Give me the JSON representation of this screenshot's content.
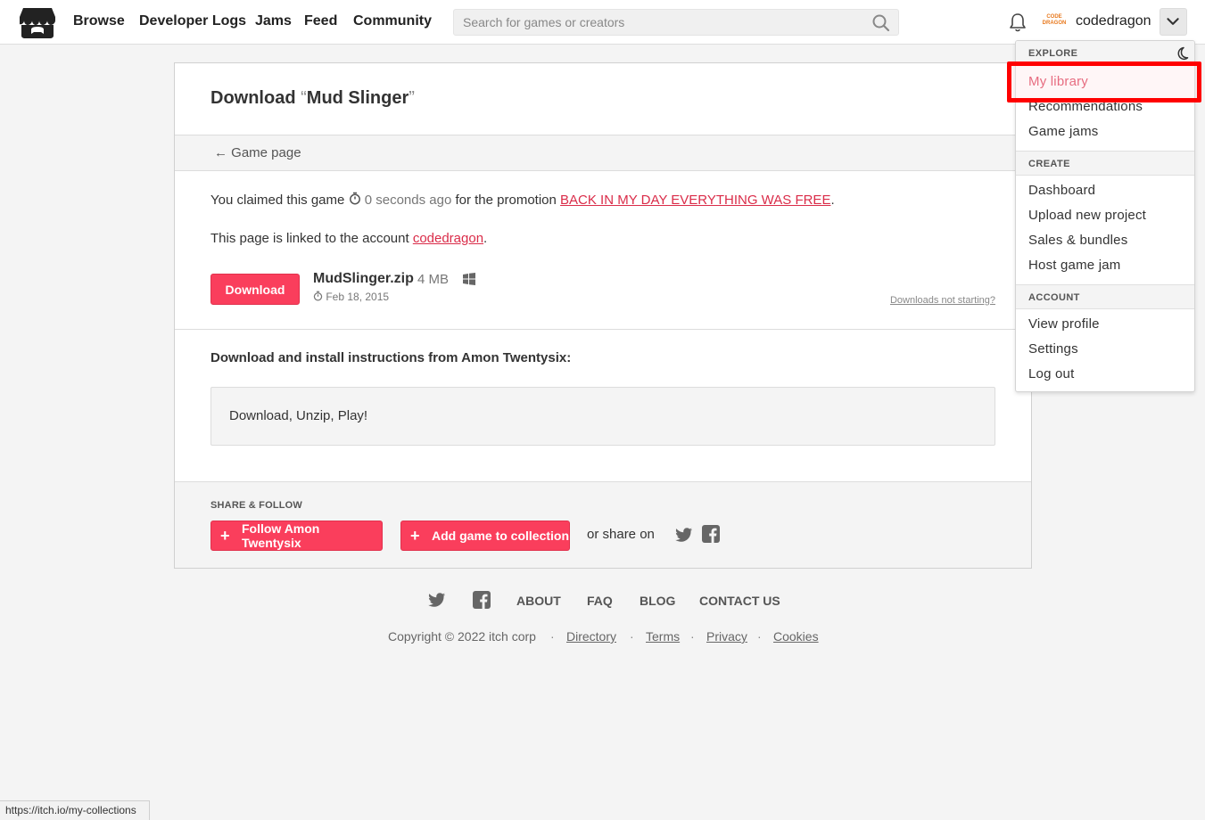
{
  "header": {
    "nav": [
      "Browse",
      "Developer Logs",
      "Jams",
      "Feed",
      "Community"
    ],
    "search_placeholder": "Search for games or creators",
    "avatar_text": "CODE DRAGON",
    "username": "codedragon"
  },
  "page": {
    "title_prefix": "Download ",
    "open_quote": "“",
    "game_title": "Mud Slinger",
    "close_quote": "”",
    "game_page_link": "Game page",
    "claim_text": "You claimed this game",
    "claim_time": "0 seconds ago",
    "claim_mid": "for the promotion",
    "promotion": "BACK IN MY DAY EVERYTHING WAS FREE",
    "period": ".",
    "linked_text": "This page is linked to the account",
    "linked_account": "codedragon",
    "download_label": "Download",
    "file_name": "MudSlinger.zip",
    "file_size": "4 MB",
    "file_date": "Feb 18, 2015",
    "downloads_not_starting": "Downloads not starting?",
    "instructions_title": "Download and install instructions from Amon Twentysix:",
    "instructions_text": "Download, Unzip, Play!",
    "share_label": "SHARE & FOLLOW",
    "follow_button": "Follow Amon Twentysix",
    "add_collection_button": "Add game to collection",
    "share_on": "or share on"
  },
  "footer": {
    "links": [
      "ABOUT",
      "FAQ",
      "BLOG",
      "CONTACT US"
    ],
    "copyright": "Copyright © 2022 itch corp",
    "small_links": [
      "Directory",
      "Terms",
      "Privacy",
      "Cookies"
    ]
  },
  "dropdown": {
    "sections": [
      {
        "title": "EXPLORE",
        "items": [
          "My library",
          "Recommendations",
          "Game jams"
        ]
      },
      {
        "title": "CREATE",
        "items": [
          "Dashboard",
          "Upload new project",
          "Sales & bundles",
          "Host game jam"
        ]
      },
      {
        "title": "ACCOUNT",
        "items": [
          "View profile",
          "Settings",
          "Log out"
        ]
      }
    ]
  },
  "status_url": "https://itch.io/my-collections",
  "colors": {
    "accent": "#fa3e5c",
    "link": "#da2c49",
    "highlight": "#ff0000"
  },
  "icons": {
    "logo": "itch-logo-icon",
    "search": "search-icon",
    "bell": "bell-icon",
    "chevron": "chevron-down-icon",
    "moon": "moon-icon",
    "timer": "stopwatch-icon",
    "windows": "windows-icon",
    "twitter": "twitter-icon",
    "facebook": "facebook-icon"
  }
}
